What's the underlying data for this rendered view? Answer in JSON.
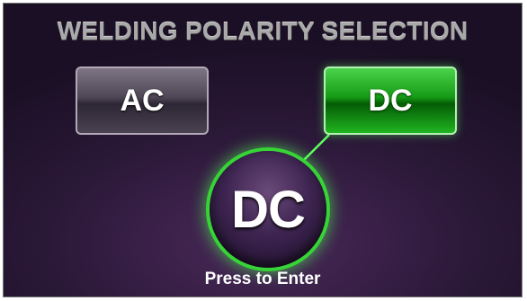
{
  "screen": {
    "title": "WELDING POLARITY SELECTION",
    "options": {
      "ac_label": "AC",
      "dc_label": "DC"
    },
    "selected": "DC",
    "knob": {
      "label": "DC"
    },
    "hint": "Press to Enter"
  },
  "colors": {
    "selected_accent": "#28c828",
    "background": "#2b1838",
    "title_text": "#a9a9a9"
  }
}
